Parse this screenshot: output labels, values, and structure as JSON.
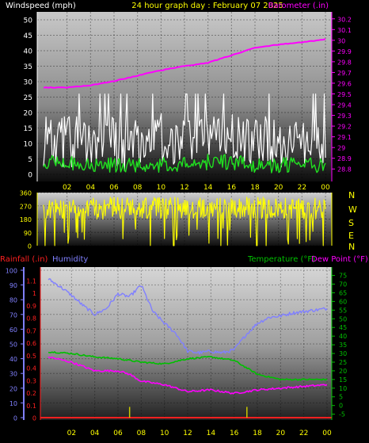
{
  "header": {
    "title": "24 hour graph day : February 07 2025",
    "left_label": "Windspeed (mph)",
    "right_label": "Barometer (.in)"
  },
  "direction_labels": [
    "N",
    "W",
    "S",
    "E",
    "N"
  ],
  "bottom_header": {
    "rainfall": "Rainfall (.in)",
    "humidity": "Humidity",
    "temperature": "Temperature (°F)",
    "dewpoint": "Dew Point (°F)"
  },
  "colors": {
    "wind_gust": "#ffffff",
    "wind_avg": "#20e020",
    "barometer": "#ff00ff",
    "direction": "#ffff00",
    "rain": "#ff2020",
    "humidity": "#8080ff",
    "temperature": "#00c000",
    "dewpoint": "#ff00ff",
    "x_tick_labels": "#ffff00"
  },
  "chart_data": [
    {
      "type": "line",
      "name": "wind-barometer",
      "x_ticks": [
        "02",
        "04",
        "06",
        "08",
        "10",
        "12",
        "14",
        "16",
        "18",
        "20",
        "22",
        "00"
      ],
      "y_left_ticks": [
        "0",
        "5",
        "10",
        "15",
        "20",
        "25",
        "30",
        "35",
        "40",
        "45",
        "50"
      ],
      "y_left_range": [
        0,
        50
      ],
      "y_right_ticks": [
        "28.8",
        "28.9",
        "29",
        "29.1",
        "29.2",
        "29.3",
        "29.4",
        "29.5",
        "29.6",
        "29.7",
        "29.8",
        "29.9",
        "30",
        "30.1",
        "30.2"
      ],
      "y_right_range": [
        28.75,
        30.25
      ],
      "series": [
        {
          "key": "gust",
          "axis": "left",
          "x": [
            0,
            1,
            2,
            3,
            4,
            5,
            6,
            7,
            8,
            9,
            10,
            11,
            12,
            13,
            14,
            15,
            16,
            17,
            18,
            19,
            20,
            21,
            22,
            23,
            24
          ],
          "values": [
            11,
            12,
            11,
            12,
            12,
            11,
            11,
            10,
            11,
            11,
            12,
            12,
            13,
            12,
            12,
            13,
            12,
            11,
            11,
            11,
            11,
            11,
            10,
            10,
            10
          ]
        },
        {
          "key": "avg",
          "axis": "left",
          "x": [
            0,
            2,
            4,
            6,
            8,
            10,
            12,
            14,
            16,
            18,
            20,
            22,
            24
          ],
          "values": [
            4,
            4,
            3,
            3,
            3,
            3,
            3,
            4,
            4,
            3,
            3,
            3,
            3
          ]
        },
        {
          "key": "barometer",
          "axis": "right",
          "x": [
            0,
            2,
            4,
            5,
            6,
            8,
            10,
            12,
            14,
            16,
            18,
            20,
            22,
            24
          ],
          "values": [
            29.56,
            29.56,
            29.58,
            29.6,
            29.62,
            29.67,
            29.72,
            29.76,
            29.79,
            29.86,
            29.93,
            29.96,
            29.98,
            30.01
          ]
        }
      ]
    },
    {
      "type": "scatter",
      "name": "wind-direction",
      "y_ticks": [
        "0",
        "90",
        "180",
        "270",
        "360"
      ],
      "y_range": [
        0,
        360
      ],
      "typical_range": [
        180,
        330
      ]
    },
    {
      "type": "line",
      "name": "rain-humidity-temp",
      "y_humidity_ticks": [
        "0",
        "10",
        "20",
        "30",
        "40",
        "50",
        "60",
        "70",
        "80",
        "90",
        "100"
      ],
      "y_rain_ticks": [
        "0",
        "0.1",
        "0.2",
        "0.3",
        "0.4",
        "0.5",
        "0.6",
        "0.7",
        "0.8",
        "0.9",
        "1",
        "1.1"
      ],
      "y_temp_ticks": [
        "-5",
        "0",
        "5",
        "10",
        "15",
        "20",
        "25",
        "30",
        "35",
        "40",
        "45",
        "50",
        "55",
        "60",
        "65",
        "70",
        "75"
      ],
      "y_temp_range": [
        -7,
        78
      ],
      "series": [
        {
          "key": "humidity",
          "axis": "humidity",
          "x": [
            0,
            1,
            2,
            3,
            4,
            5,
            6,
            7,
            8,
            9,
            10,
            11,
            12,
            13,
            14,
            15,
            16,
            17,
            18,
            19,
            20,
            21,
            22,
            23,
            24
          ],
          "values": [
            94,
            89,
            83,
            76,
            70,
            74,
            84,
            82,
            90,
            72,
            64,
            57,
            45,
            44,
            45,
            44,
            46,
            56,
            64,
            68,
            69,
            71,
            72,
            73,
            74
          ]
        },
        {
          "key": "temperature",
          "axis": "temp",
          "x": [
            0,
            2,
            4,
            6,
            8,
            10,
            12,
            14,
            16,
            18,
            20,
            22,
            24
          ],
          "values": [
            31,
            30,
            28,
            27,
            25,
            24,
            27,
            28,
            26,
            18,
            15,
            15,
            15
          ]
        },
        {
          "key": "dewpoint",
          "axis": "temp",
          "x": [
            0,
            2,
            4,
            6,
            7,
            8,
            10,
            12,
            14,
            16,
            18,
            20,
            22,
            24
          ],
          "values": [
            28,
            25,
            20,
            20,
            18,
            14,
            12,
            8,
            9,
            7,
            9,
            10,
            11,
            12
          ]
        },
        {
          "key": "rain",
          "axis": "rain",
          "x": [
            7.0,
            17.1
          ],
          "values": [
            0.01,
            0.01
          ]
        }
      ]
    }
  ]
}
